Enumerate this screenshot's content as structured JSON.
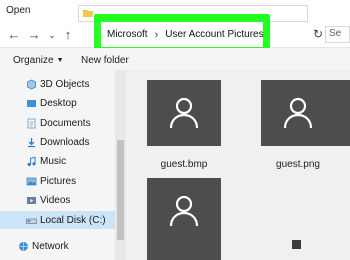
{
  "window": {
    "title": "Open"
  },
  "address": {
    "breadcrumbs": [
      "Microsoft",
      "User Account Pictures"
    ],
    "separator": "›",
    "refresh_icon": "refresh-icon",
    "search_placeholder": "Se",
    "highlight_color": "#22ff22"
  },
  "toolbar": {
    "organize_label": "Organize",
    "new_folder_label": "New folder"
  },
  "sidebar": {
    "items": [
      {
        "label": "3D Objects",
        "icon": "cube-icon"
      },
      {
        "label": "Desktop",
        "icon": "desktop-folder-icon"
      },
      {
        "label": "Documents",
        "icon": "documents-icon"
      },
      {
        "label": "Downloads",
        "icon": "download-icon"
      },
      {
        "label": "Music",
        "icon": "music-icon"
      },
      {
        "label": "Pictures",
        "icon": "pictures-icon"
      },
      {
        "label": "Videos",
        "icon": "videos-icon"
      },
      {
        "label": "Local Disk (C:)",
        "icon": "drive-icon"
      },
      {
        "label": "Network",
        "icon": "network-icon"
      }
    ],
    "selected": "Local Disk (C:)"
  },
  "files": [
    {
      "name": "guest.bmp",
      "icon": "user-icon"
    },
    {
      "name": "guest.png",
      "icon": "user-icon"
    },
    {
      "name": "",
      "icon": "user-icon"
    }
  ]
}
